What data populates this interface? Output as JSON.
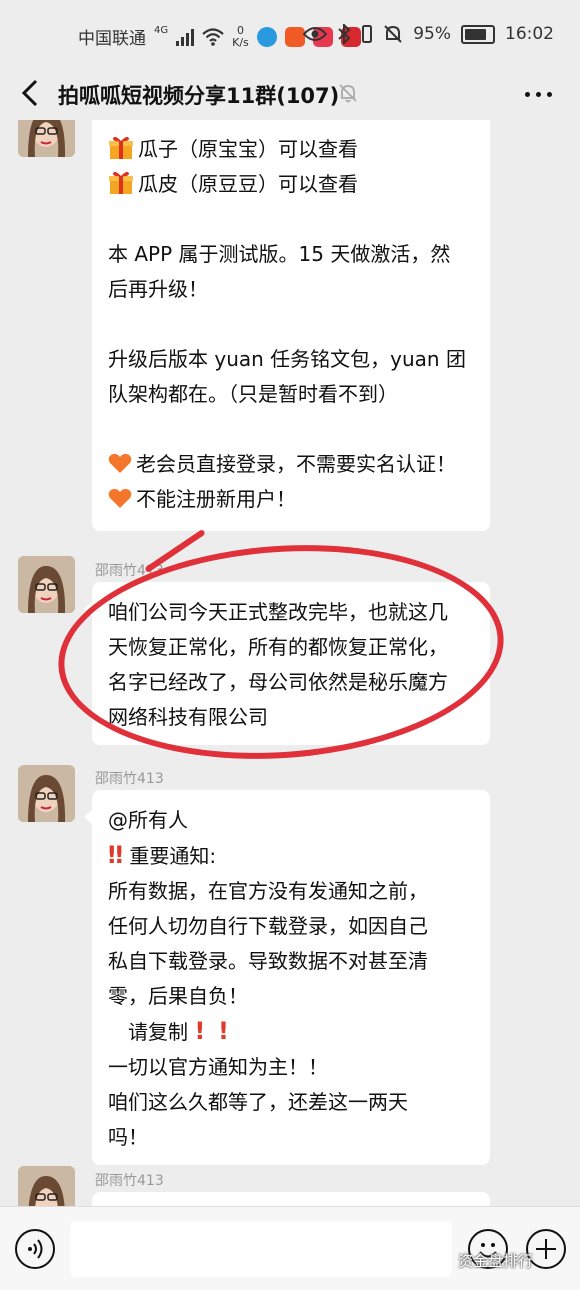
{
  "status_bar": {
    "carrier": "中国联通",
    "network": "4G",
    "speed_value": "0",
    "speed_unit": "K/s",
    "battery": "95%",
    "time": "16:02"
  },
  "header": {
    "title": "拍呱呱短视频分享11群(107)"
  },
  "messages": [
    {
      "sender": "",
      "lines": [
        "瓜子（原宝宝）可以查看",
        "瓜皮（原豆豆）可以查看",
        "",
        "本 APP 属于测试版。15 天做激活，然",
        "后再升级！",
        "",
        "升级后版本 yuan 任务铭文包，yuan 团",
        "队架构都在。（只是暂时看不到）",
        "",
        "老会员直接登录，不需要实名认证！",
        "不能注册新用户！"
      ]
    },
    {
      "sender": "邵雨竹413",
      "lines": [
        "咱们公司今天正式整改完毕，也就这几",
        "天恢复正常化，所有的都恢复正常化，",
        "名字已经改了，母公司依然是秘乐魔方",
        "网络科技有限公司"
      ]
    },
    {
      "sender": "邵雨竹413",
      "lines": [
        "@所有人",
        "重要通知:",
        "所有数据，在官方没有发通知之前，",
        "任何人切勿自行下载登录，如因自己",
        "私自下载登录。导致数据不对甚至清",
        "零，后果自负！",
        "请复制",
        "一切以官方通知为主！！",
        "咱们这么久都等了，还差这一两天",
        "吗！"
      ]
    },
    {
      "sender": "邵雨竹413",
      "lines": []
    }
  ],
  "watermark": "资金盘排行",
  "colors": {
    "background": "#ededed",
    "bubble": "#ffffff",
    "annotation": "#e0303a"
  }
}
